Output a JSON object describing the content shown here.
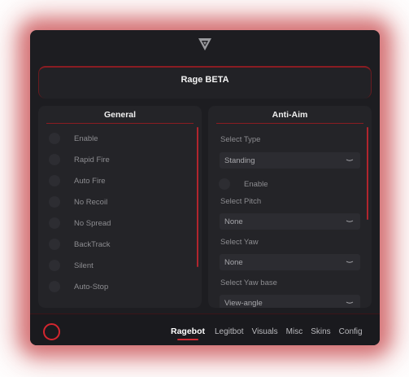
{
  "window": {
    "title": "Rage BETA",
    "accent_color": "#cc2a33",
    "logo_icon": "triangle-logo-icon"
  },
  "general": {
    "header": "General",
    "items": [
      {
        "label": "Enable",
        "checked": false
      },
      {
        "label": "Rapid Fire",
        "checked": false
      },
      {
        "label": "Auto Fire",
        "checked": false
      },
      {
        "label": "No Recoil",
        "checked": false
      },
      {
        "label": "No Spread",
        "checked": false
      },
      {
        "label": "BackTrack",
        "checked": false
      },
      {
        "label": "Silent",
        "checked": false
      },
      {
        "label": "Auto-Stop",
        "checked": false
      }
    ]
  },
  "anti_aim": {
    "header": "Anti-Aim",
    "select_type": {
      "label": "Select Type",
      "value": "Standing"
    },
    "enable": {
      "label": "Enable",
      "checked": false
    },
    "select_pitch": {
      "label": "Select Pitch",
      "value": "None"
    },
    "select_yaw": {
      "label": "Select Yaw",
      "value": "None"
    },
    "select_yaw_base": {
      "label": "Select Yaw base",
      "value": "View-angle"
    }
  },
  "bottom": {
    "power_icon": "power-ring-icon",
    "tabs": [
      {
        "label": "Ragebot",
        "active": true
      },
      {
        "label": "Legitbot",
        "active": false
      },
      {
        "label": "Visuals",
        "active": false
      },
      {
        "label": "Misc",
        "active": false
      },
      {
        "label": "Skins",
        "active": false
      },
      {
        "label": "Config",
        "active": false
      }
    ]
  }
}
